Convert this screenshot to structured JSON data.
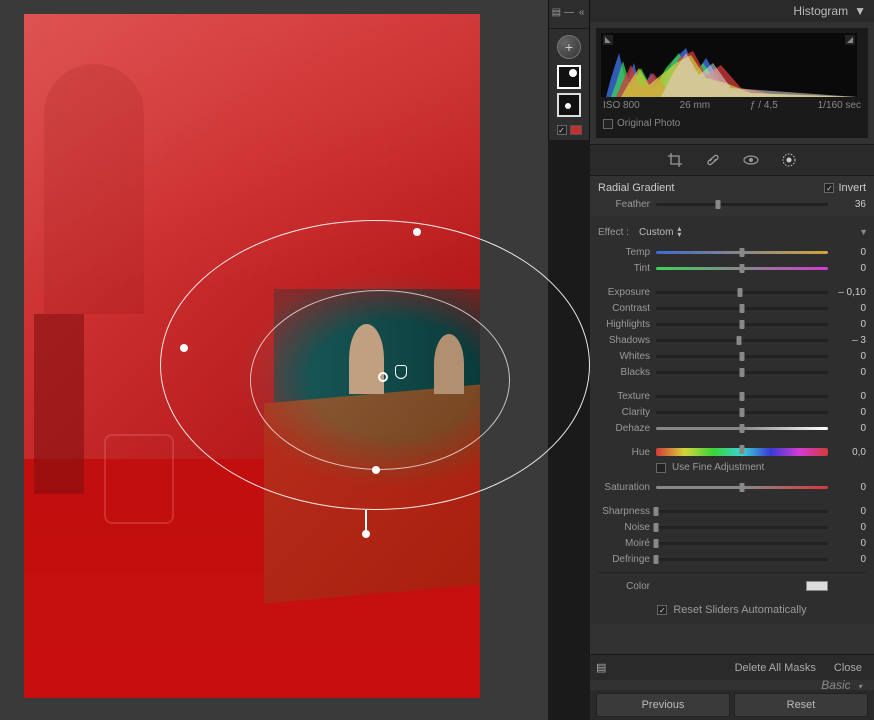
{
  "header": {
    "title": "Histogram"
  },
  "histogram": {
    "iso": "ISO 800",
    "focal": "26 mm",
    "aperture": "ƒ / 4,5",
    "shutter": "1/160 sec",
    "original_label": "Original Photo"
  },
  "mask": {
    "title": "Radial Gradient",
    "invert_label": "Invert",
    "invert_checked": true,
    "feather": {
      "label": "Feather",
      "value": "36",
      "pos": 36
    }
  },
  "effect": {
    "label": "Effect :",
    "selected": "Custom"
  },
  "sliders": {
    "temp": {
      "label": "Temp",
      "value": "0",
      "pos": 50,
      "class": "gradient-temp"
    },
    "tint": {
      "label": "Tint",
      "value": "0",
      "pos": 50,
      "class": "gradient-tint"
    },
    "exposure": {
      "label": "Exposure",
      "value": "– 0,10",
      "pos": 49
    },
    "contrast": {
      "label": "Contrast",
      "value": "0",
      "pos": 50
    },
    "highlights": {
      "label": "Highlights",
      "value": "0",
      "pos": 50
    },
    "shadows": {
      "label": "Shadows",
      "value": "– 3",
      "pos": 48.5
    },
    "whites": {
      "label": "Whites",
      "value": "0",
      "pos": 50
    },
    "blacks": {
      "label": "Blacks",
      "value": "0",
      "pos": 50
    },
    "texture": {
      "label": "Texture",
      "value": "0",
      "pos": 50
    },
    "clarity": {
      "label": "Clarity",
      "value": "0",
      "pos": 50
    },
    "dehaze": {
      "label": "Dehaze",
      "value": "0",
      "pos": 50,
      "class": "gradient-dehaze"
    },
    "hue": {
      "label": "Hue",
      "value": "0,0",
      "pos": 50,
      "class": "gradient-hue-full"
    },
    "saturation": {
      "label": "Saturation",
      "value": "0",
      "pos": 50,
      "class": "gradient-sat"
    },
    "sharpness": {
      "label": "Sharpness",
      "value": "0",
      "pos": 0
    },
    "noise": {
      "label": "Noise",
      "value": "0",
      "pos": 0
    },
    "moire": {
      "label": "Moiré",
      "value": "0",
      "pos": 0
    },
    "defringe": {
      "label": "Defringe",
      "value": "0",
      "pos": 0
    }
  },
  "fine_adj": {
    "label": "Use Fine Adjustment",
    "checked": false
  },
  "color": {
    "label": "Color"
  },
  "reset_auto": {
    "label": "Reset Sliders Automatically",
    "checked": true
  },
  "footer": {
    "delete_all": "Delete All Masks",
    "close": "Close",
    "basic": "Basic"
  },
  "buttons": {
    "previous": "Previous",
    "reset": "Reset"
  },
  "icons": {
    "add_mask": "+",
    "crop": "crop-icon",
    "heal": "heal-icon",
    "redeye": "redeye-icon",
    "masking": "masking-icon"
  }
}
